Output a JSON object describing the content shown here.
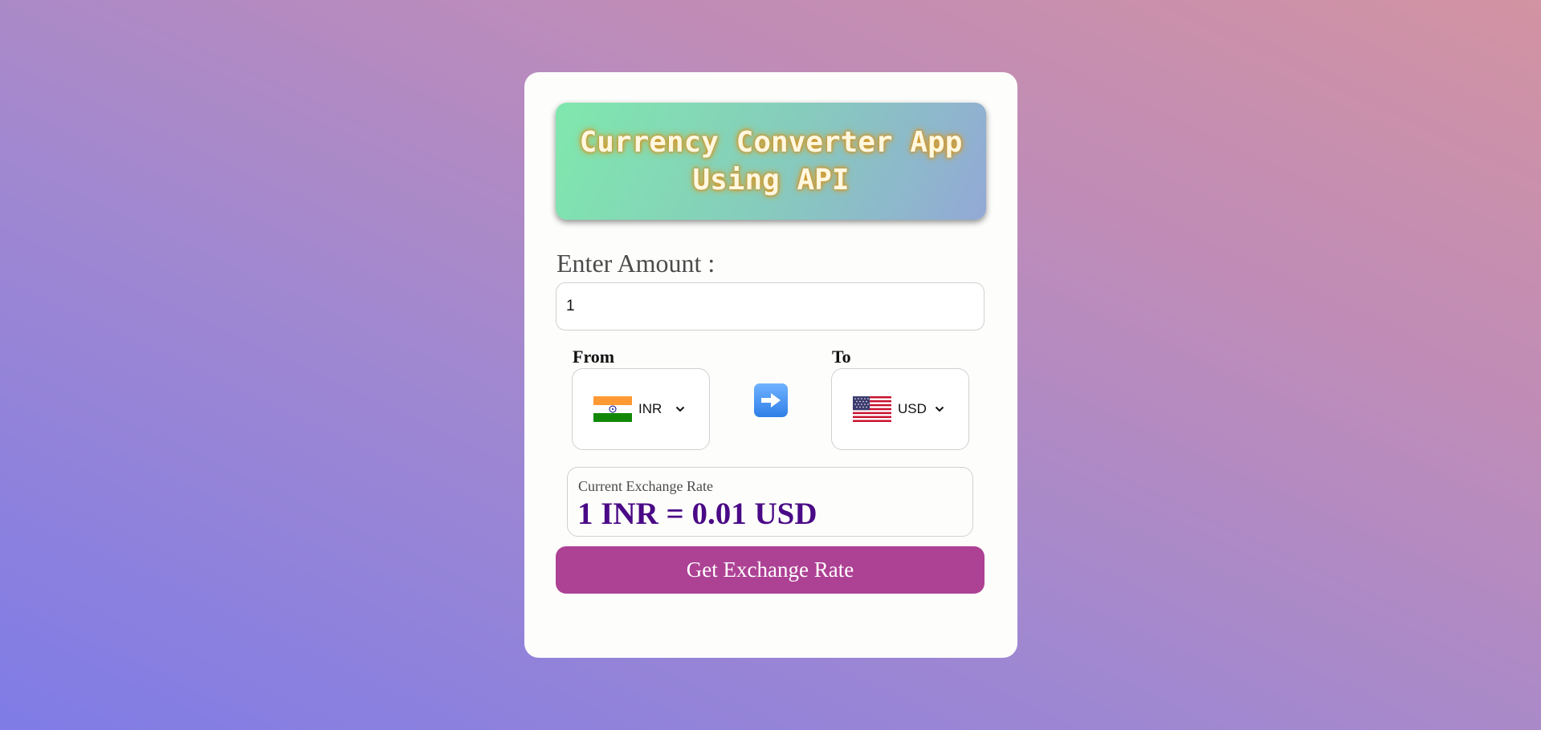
{
  "header": {
    "title": "Currency Converter App Using API"
  },
  "amount": {
    "label": "Enter Amount :",
    "value": "1"
  },
  "from": {
    "label": "From",
    "currency": "INR",
    "flag_icon": "india-flag-icon"
  },
  "to": {
    "label": "To",
    "currency": "USD",
    "flag_icon": "us-flag-icon"
  },
  "swap": {
    "icon": "right-arrow-icon"
  },
  "exchange": {
    "label": "Current Exchange Rate",
    "result": "1 INR = 0.01 USD"
  },
  "action": {
    "button_label": "Get Exchange Rate"
  },
  "colors": {
    "button": "#ad4194",
    "result_text": "#4a0a86",
    "header_start": "#7fe8ad",
    "header_end": "#93a9d6"
  }
}
